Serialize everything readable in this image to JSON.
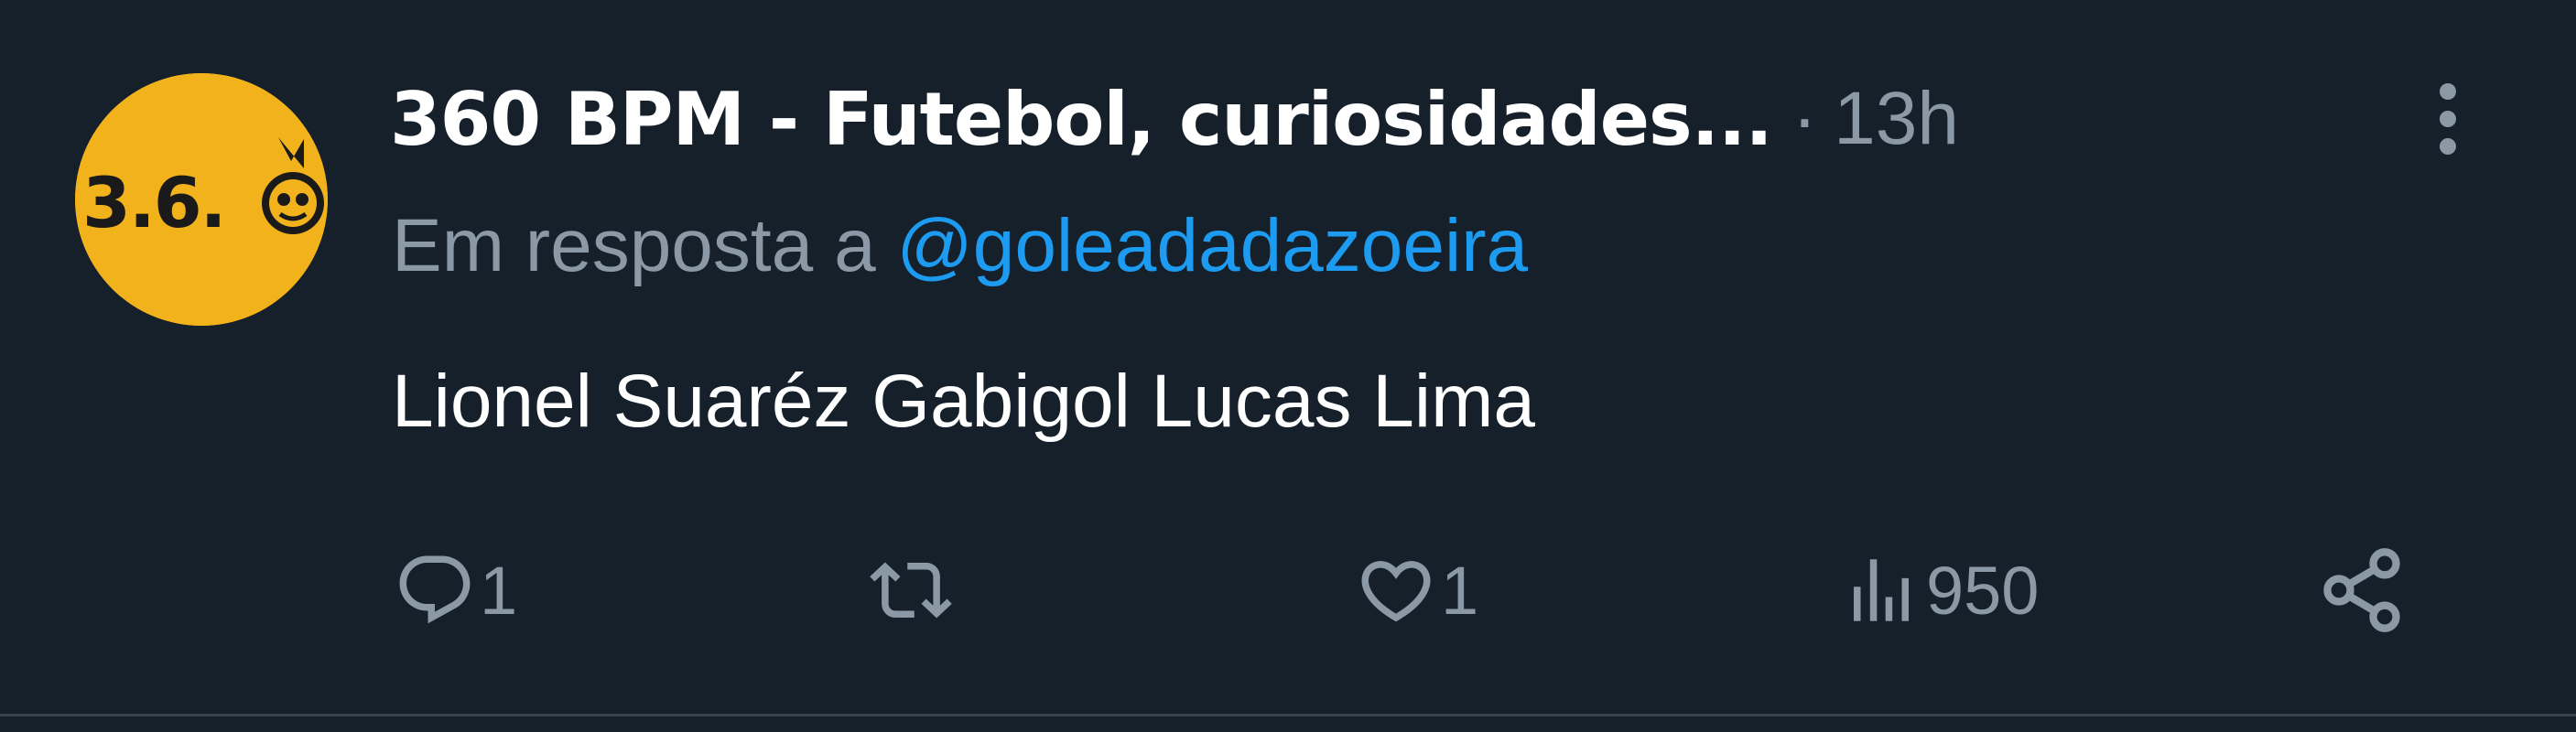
{
  "author": {
    "display_name": "360 BPM - Futebol, curiosidades...",
    "avatar_text": "3.6.",
    "avatar_color": "#f2b21b"
  },
  "separator": "·",
  "timestamp": "13h",
  "reply_context": {
    "prefix": "Em resposta a",
    "mention": "@goleadadazoeira"
  },
  "body": "Lionel Suaréz Gabigol Lucas Lima",
  "actions": {
    "reply_count": "1",
    "retweet_count": "",
    "like_count": "1",
    "views_count": "950"
  },
  "icons": {
    "more": "more-vertical-icon",
    "reply": "reply-icon",
    "retweet": "retweet-icon",
    "like": "heart-icon",
    "views": "views-icon",
    "share": "share-icon"
  },
  "colors": {
    "background": "#15202b",
    "secondary_text": "#8b98a5",
    "link": "#1d9bf0",
    "primary_text": "#ffffff"
  }
}
